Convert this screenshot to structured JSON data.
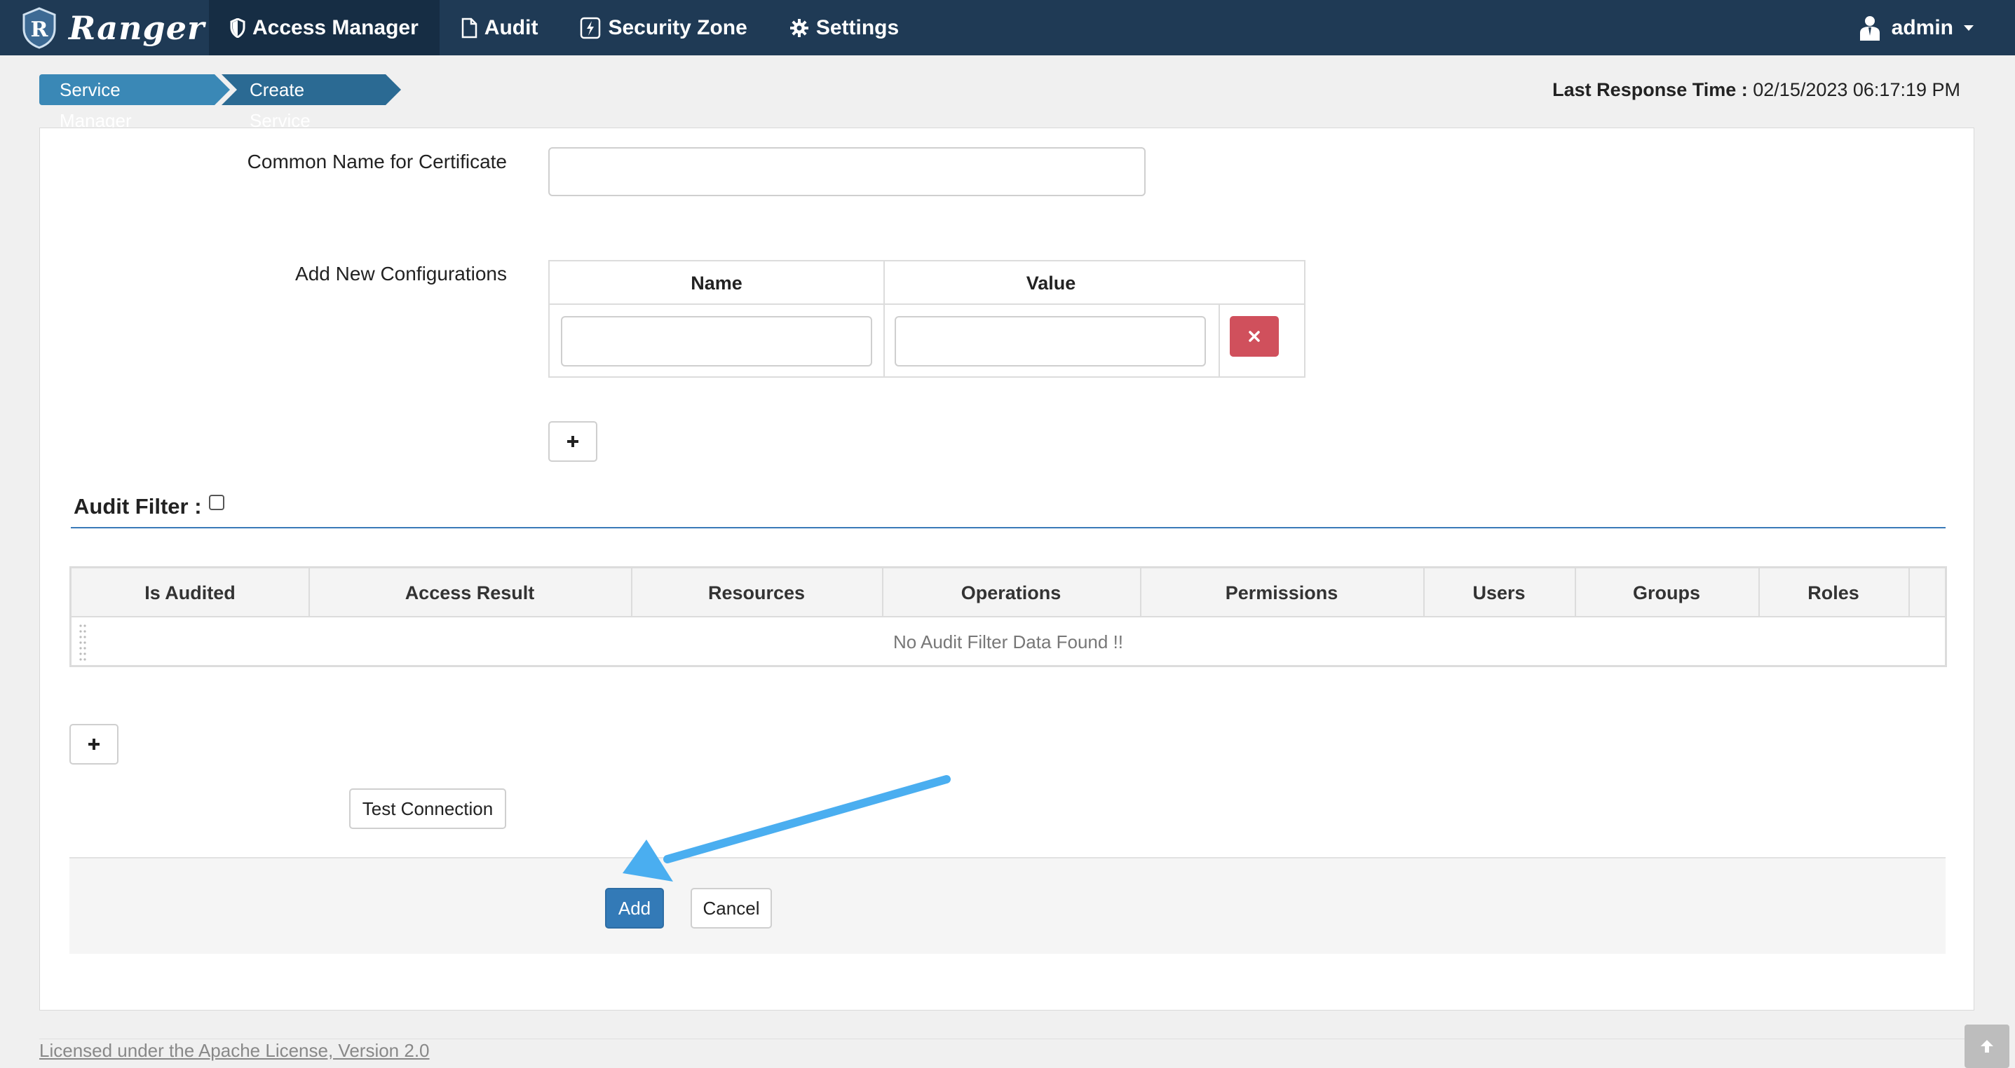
{
  "navbar": {
    "brand": "Ranger",
    "items": [
      {
        "label": "Access Manager",
        "icon": "shield-icon",
        "active": true
      },
      {
        "label": "Audit",
        "icon": "file-icon",
        "active": false
      },
      {
        "label": "Security Zone",
        "icon": "zone-icon",
        "active": false
      },
      {
        "label": "Settings",
        "icon": "gear-icon",
        "active": false
      }
    ],
    "user": "admin"
  },
  "breadcrumb": [
    "Service Manager",
    "Create Service"
  ],
  "last_response": {
    "label": "Last Response Time :",
    "value": "02/15/2023 06:17:19 PM"
  },
  "form": {
    "common_name_label": "Common Name for Certificate",
    "common_name_value": "",
    "add_configs_label": "Add New Configurations",
    "config_table": {
      "headers": [
        "Name",
        "Value"
      ],
      "rows": [
        {
          "name": "",
          "value": ""
        }
      ]
    }
  },
  "audit_filter": {
    "title": "Audit Filter :",
    "checked": false,
    "headers": [
      "Is Audited",
      "Access Result",
      "Resources",
      "Operations",
      "Permissions",
      "Users",
      "Groups",
      "Roles"
    ],
    "empty_text": "No Audit Filter Data Found !!"
  },
  "buttons": {
    "test_connection": "Test Connection",
    "add": "Add",
    "cancel": "Cancel"
  },
  "footer": {
    "license": "Licensed under the Apache License, Version 2.0"
  },
  "colors": {
    "navbar": "#1f3a55",
    "primary": "#337ab7",
    "danger": "#d0505c",
    "annotation_arrow": "#4aaef0"
  }
}
